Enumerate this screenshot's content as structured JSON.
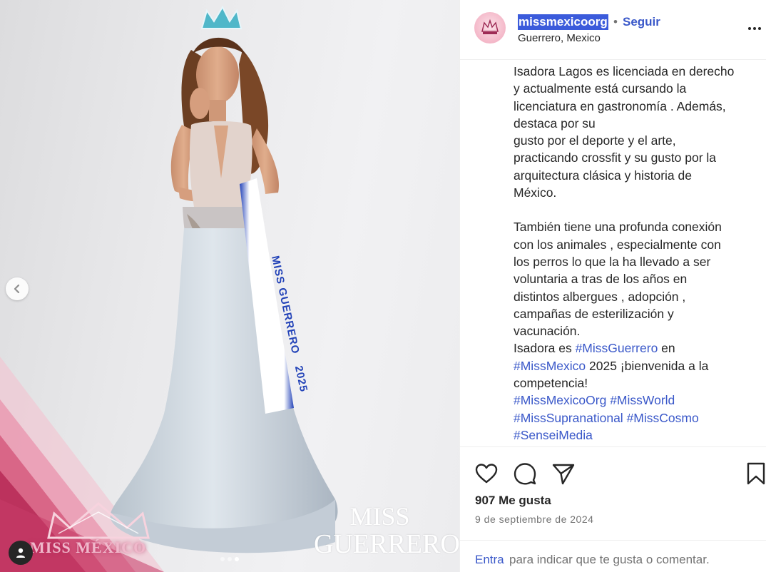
{
  "post": {
    "image": {
      "sash_line1": "MISS GUERRERO",
      "sash_line2": "2025",
      "brand_text": "MISS MÉXICO",
      "watermark_line1": "MISS",
      "watermark_line2": "GUERRERO",
      "carousel_dots": 3,
      "active_dot": 2
    },
    "header": {
      "username": "missmexicoorg",
      "separator": "•",
      "follow_label": "Seguir",
      "location": "Guerrero, Mexico"
    },
    "caption": {
      "paragraph1": "Isadora Lagos es licenciada en derecho\ny actualmente está cursando la\nlicenciatura en gastronomía . Además,\ndestaca por su\ngusto por el deporte y el arte,\npracticando crossfit  y su gusto por la\narquitectura clásica y historia de\nMéxico.",
      "paragraph2": "También tiene una profunda conexión\ncon los animales , especialmente con\nlos perros lo que la ha llevado a ser\nvoluntaria a tras de los años en\ndistintos albergues , adopción ,\ncampañas de esterilización y\nvacunación.",
      "line_a_prefix": "Isadora es ",
      "hashtag_guerrero": "#MissGuerrero",
      "line_a_suffix": " en",
      "hashtag_mexico": "#MissMexico",
      "line_b_suffix": " 2025 ¡bienvenida a la",
      "line_c": "competencia!",
      "hashtag_org": "#MissMexicoOrg",
      "hashtag_world": "#MissWorld",
      "hashtag_supra": "#MissSupranational",
      "hashtag_cosmo": "#MissCosmo",
      "hashtag_sensei": "#SenseiMedia"
    },
    "actions": {
      "likes": "907 Me gusta",
      "date": "9 de septiembre de 2024",
      "login_link": "Entra",
      "login_rest": "para indicar que te gusta o comentar."
    }
  },
  "icons": {
    "prev": "chevron-left-icon",
    "user_tag": "user-icon",
    "more": "more-options-icon",
    "like": "heart-icon",
    "comment": "comment-icon",
    "share": "send-icon",
    "save": "bookmark-icon"
  },
  "colors": {
    "link": "#3a58c9",
    "username_highlight": "#3b5bdb",
    "muted": "#737373",
    "text": "#262626",
    "brand_pink": "#c2185b"
  }
}
